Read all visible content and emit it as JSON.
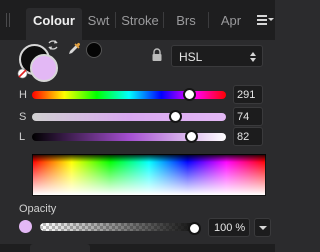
{
  "tabs": [
    {
      "label": "Colour",
      "active": true
    },
    {
      "label": "Swt",
      "active": false
    },
    {
      "label": "Stroke",
      "active": false
    },
    {
      "label": "Brs",
      "active": false
    },
    {
      "label": "Apr",
      "active": false
    }
  ],
  "swatches": {
    "fill_color": "#e3b8f5",
    "stroke_color": "#0d0d0d",
    "picker_color": "#050505"
  },
  "model": {
    "selected": "HSL"
  },
  "sliders": [
    {
      "label": "H",
      "value": "291",
      "fraction": 0.81
    },
    {
      "label": "S",
      "value": "74",
      "fraction": 0.74
    },
    {
      "label": "L",
      "value": "82",
      "fraction": 0.82
    }
  ],
  "opacity": {
    "label": "Opacity",
    "value": "100 %",
    "fraction": 1.0
  },
  "icons": [
    "swap-icon",
    "no-color-icon",
    "eyedropper-icon",
    "lock-icon",
    "panel-menu-icon",
    "dropdown-arrow-icon"
  ],
  "colors": {
    "accent": "#e3b8f5",
    "panel_bg": "#2b2b2d",
    "tabbar_bg": "#1e1e1f"
  }
}
